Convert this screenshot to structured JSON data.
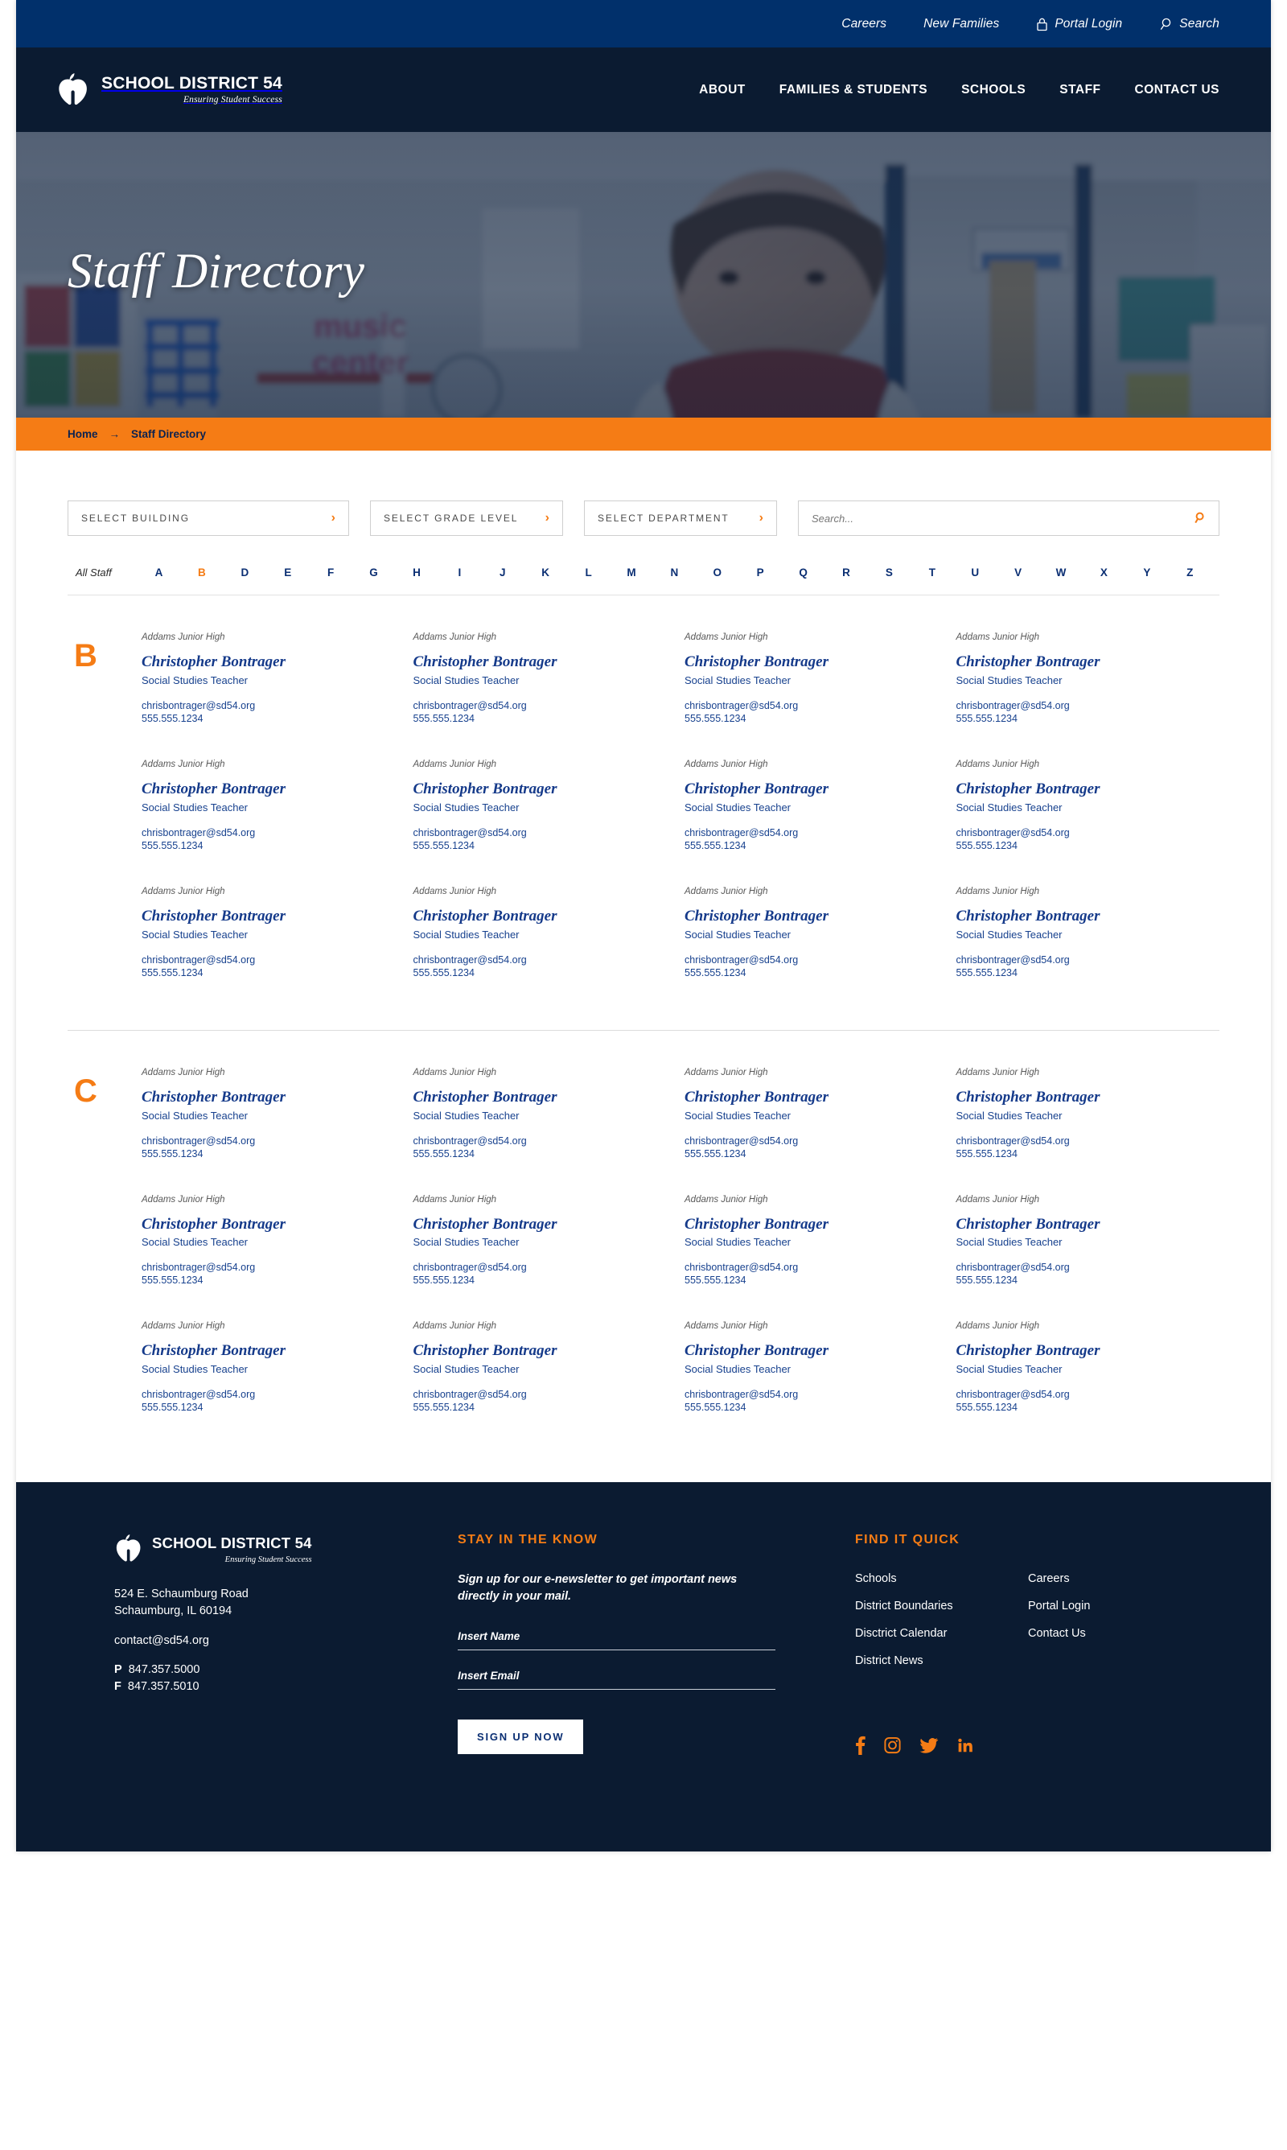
{
  "topbar": {
    "links": [
      {
        "label": "Careers",
        "icon": null
      },
      {
        "label": "New Families",
        "icon": null
      },
      {
        "label": "Portal Login",
        "icon": "lock-icon"
      },
      {
        "label": "Search",
        "icon": "search-icon"
      }
    ]
  },
  "brand": {
    "title": "SCHOOL DISTRICT 54",
    "tagline": "Ensuring Student Success",
    "logo_icon": "apple-heart-logo-icon"
  },
  "nav": {
    "items": [
      "ABOUT",
      "FAMILIES & STUDENTS",
      "SCHOOLS",
      "STAFF",
      "CONTACT US"
    ]
  },
  "hero": {
    "title": "Staff Directory"
  },
  "breadcrumb": {
    "home": "Home",
    "arrow": "→",
    "current": "Staff Directory"
  },
  "filters": {
    "building": "SELECT BUILDING",
    "grade": "SELECT GRADE LEVEL",
    "department": "SELECT DEPARTMENT",
    "search_placeholder": "Search...",
    "search_value": "",
    "chevron": "›"
  },
  "alpha": {
    "all_label": "All Staff",
    "letters": [
      "A",
      "B",
      "D",
      "E",
      "F",
      "G",
      "H",
      "I",
      "J",
      "K",
      "L",
      "M",
      "N",
      "O",
      "P",
      "Q",
      "R",
      "S",
      "T",
      "U",
      "V",
      "W",
      "X",
      "Y",
      "Z"
    ],
    "active": "B"
  },
  "person": {
    "school": "Addams Junior High",
    "name": "Christopher Bontrager",
    "role": "Social Studies Teacher",
    "email": "chrisbontrager@sd54.org",
    "phone": "555.555.1234"
  },
  "groups": [
    {
      "letter": "B",
      "count": 12
    },
    {
      "letter": "C",
      "count": 12
    }
  ],
  "footer": {
    "address_line1": "524 E. Schaumburg Road",
    "address_line2": "Schaumburg, IL 60194",
    "email": "contact@sd54.org",
    "phone_label": "P",
    "phone": "847.357.5000",
    "fax_label": "F",
    "fax": "847.357.5010",
    "newsletter": {
      "heading": "STAY IN THE KNOW",
      "blurb": "Sign up for our e-newsletter to get important news directly in your mail.",
      "name_placeholder": "Insert Name",
      "name_value": "",
      "email_placeholder": "Insert Email",
      "email_value": "",
      "button": "SIGN UP NOW"
    },
    "quick": {
      "heading": "FIND IT QUICK",
      "col1": [
        "Schools",
        "District Boundaries",
        "Disctrict Calendar",
        "District News"
      ],
      "col2": [
        "Careers",
        "Portal Login",
        "Contact Us"
      ]
    },
    "social": [
      "facebook-icon",
      "instagram-icon",
      "twitter-icon",
      "linkedin-icon"
    ]
  },
  "colors": {
    "topbar_navy": "#01306b",
    "nav_navy": "#0b1b31",
    "accent_orange": "#f57c15",
    "link_navy": "#17418e",
    "name_navy": "#153a8a"
  }
}
